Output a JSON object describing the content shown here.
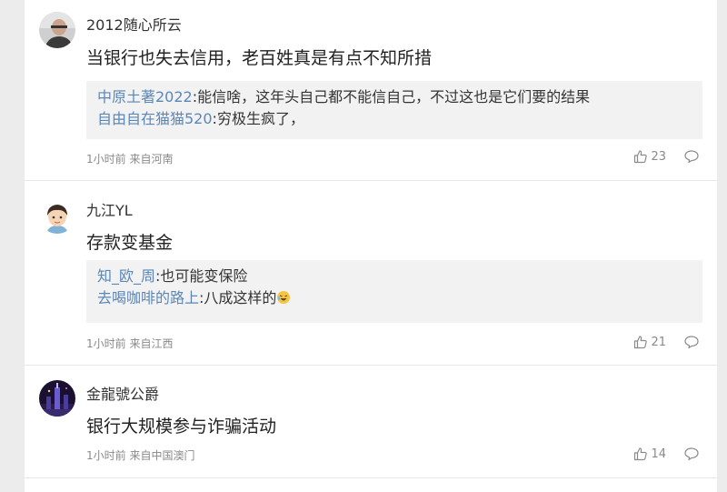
{
  "comments": [
    {
      "username": "2012随心所云",
      "text": "当银行也失去信用，老百姓真是有点不知所措",
      "replies": [
        {
          "user": "中原土著2022",
          "text": ":能信啥，这年头自己都不能信自己，不过这也是它们要的结果"
        },
        {
          "user": "自由自在猫猫520",
          "text": ":穷极生疯了，"
        }
      ],
      "meta": "1小时前 来自河南",
      "likes": "23"
    },
    {
      "username": "九江YL",
      "text": "存款变基金",
      "replies": [
        {
          "user": "知_欧_周",
          "text": ":也可能变保险"
        },
        {
          "user": "去喝咖啡的路上",
          "text": ":八成这样的"
        }
      ],
      "meta": "1小时前 来自江西",
      "likes": "21"
    },
    {
      "username": "金龍號公爵",
      "text": "银行大规模参与诈骗活动",
      "replies": [],
      "meta": "1小时前 来自中国澳门",
      "likes": "14"
    }
  ],
  "icons": {
    "like": "thumbs-up-icon",
    "comment": "speech-bubble-icon",
    "emoji": "laughing-emoji-icon"
  },
  "colors": {
    "reply_user": "#5b87b8",
    "reply_bg": "#f2f2f2",
    "meta": "#8a8a8a"
  }
}
